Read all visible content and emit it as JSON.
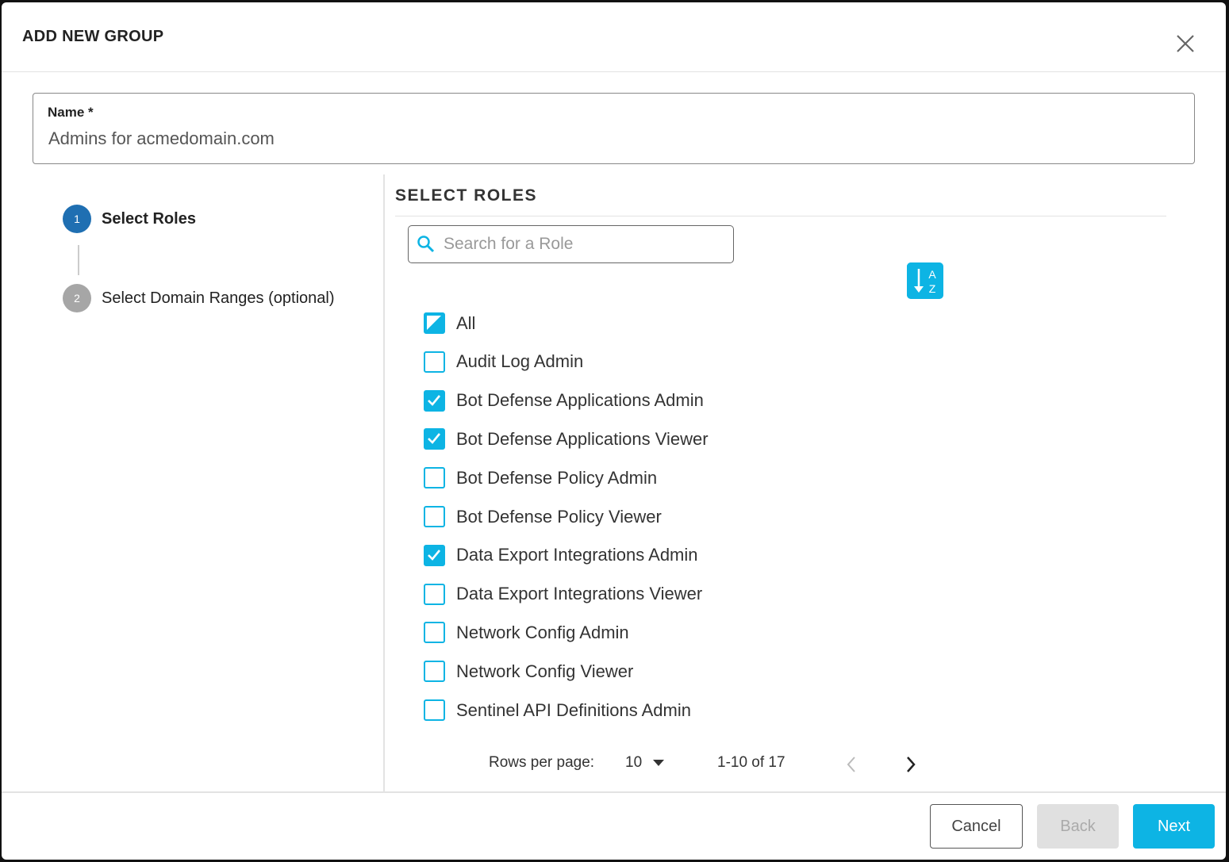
{
  "dialog": {
    "title": "ADD NEW GROUP",
    "close_icon": "close-icon"
  },
  "name_field": {
    "label": "Name *",
    "value": "Admins for acmedomain.com"
  },
  "steps": [
    {
      "number": "1",
      "label": "Select Roles",
      "active": true
    },
    {
      "number": "2",
      "label": "Select Domain Ranges (optional)",
      "active": false
    }
  ],
  "roles": {
    "title": "SELECT ROLES",
    "search_placeholder": "Search for a Role",
    "sort_icon": "sort-alpha-icon",
    "items": [
      {
        "label": "All",
        "state": "indeterminate"
      },
      {
        "label": "Audit Log Admin",
        "state": "unchecked"
      },
      {
        "label": "Bot Defense Applications Admin",
        "state": "checked"
      },
      {
        "label": "Bot Defense Applications Viewer",
        "state": "checked"
      },
      {
        "label": "Bot Defense Policy Admin",
        "state": "unchecked"
      },
      {
        "label": "Bot Defense Policy Viewer",
        "state": "unchecked"
      },
      {
        "label": "Data Export Integrations Admin",
        "state": "checked"
      },
      {
        "label": "Data Export Integrations Viewer",
        "state": "unchecked"
      },
      {
        "label": "Network Config Admin",
        "state": "unchecked"
      },
      {
        "label": "Network Config Viewer",
        "state": "unchecked"
      },
      {
        "label": "Sentinel API Definitions Admin",
        "state": "unchecked"
      }
    ]
  },
  "pagination": {
    "rows_label": "Rows per page:",
    "rows_value": "10",
    "range": "1-10 of 17"
  },
  "footer": {
    "cancel": "Cancel",
    "back": "Back",
    "next": "Next"
  },
  "colors": {
    "accent": "#0db4e4",
    "step_active": "#1f6fb2",
    "step_inactive": "#a6a6a6",
    "disabled": "#e0e0e0"
  }
}
